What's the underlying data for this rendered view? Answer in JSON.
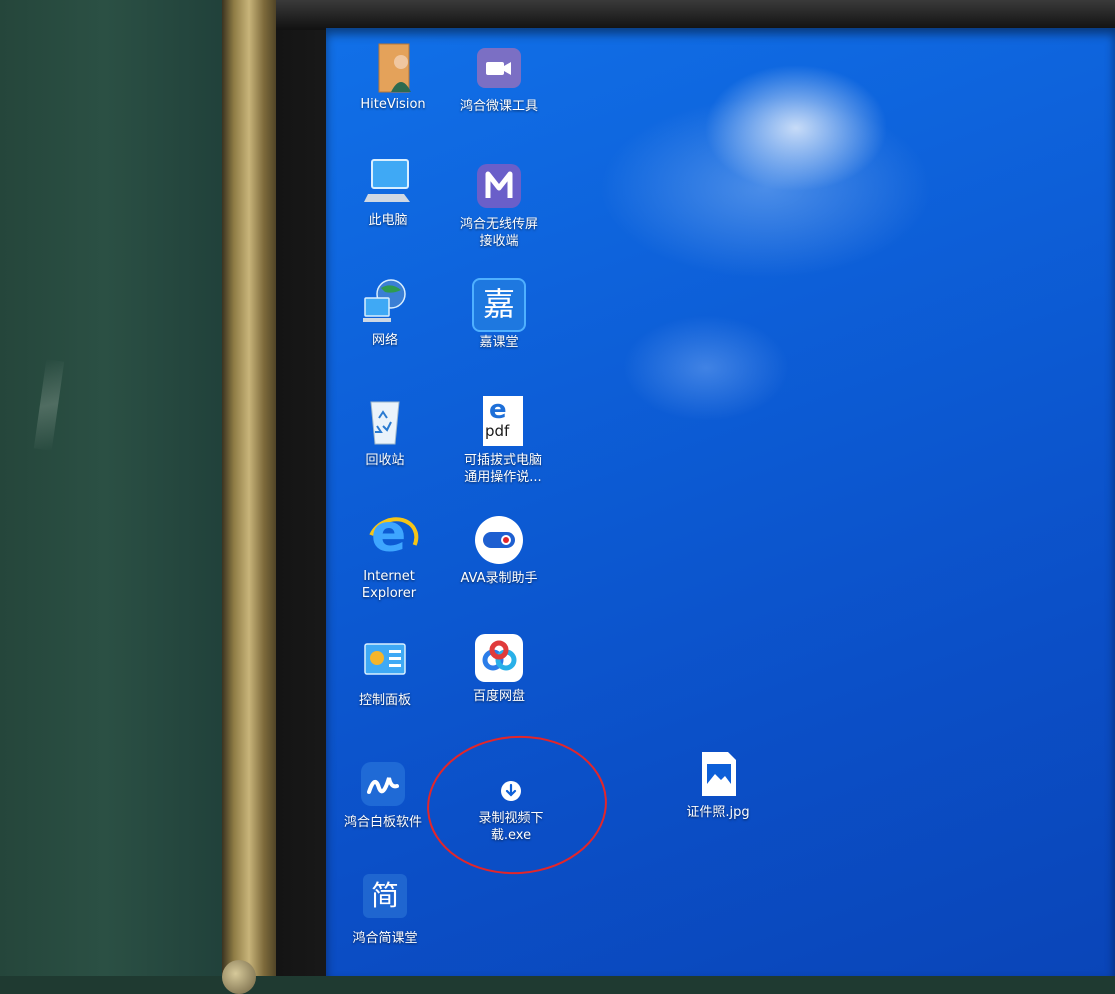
{
  "desktop": {
    "icons": [
      {
        "label": "HiteVision",
        "icon": "person-hitevision-icon"
      },
      {
        "label": "鸿合微课工具",
        "icon": "video-camera-icon"
      },
      {
        "label": "此电脑",
        "icon": "computer-icon"
      },
      {
        "label": "鸿合无线传屏\n接收端",
        "icon": "wireless-screen-icon"
      },
      {
        "label": "网络",
        "icon": "network-globe-icon"
      },
      {
        "label": "嘉课堂",
        "icon": "jia-classroom-icon",
        "glyph": "嘉"
      },
      {
        "label": "回收站",
        "icon": "recycle-bin-icon"
      },
      {
        "label": "可插拔式电脑\n通用操作说...",
        "icon": "pdf-file-icon",
        "glyph": "pdf"
      },
      {
        "label": "Internet\nExplorer",
        "icon": "internet-explorer-icon",
        "glyph": "e"
      },
      {
        "label": "AVA录制助手",
        "icon": "ava-record-icon"
      },
      {
        "label": "控制面板",
        "icon": "control-panel-icon"
      },
      {
        "label": "百度网盘",
        "icon": "baidu-netdisk-icon"
      },
      {
        "label": "鸿合白板软件",
        "icon": "whiteboard-pen-icon"
      },
      {
        "label": "录制视频下\n载.exe",
        "icon": "download-arrow-icon"
      },
      {
        "label": "证件照.jpg",
        "icon": "image-file-icon"
      },
      {
        "label": "鸿合简课堂",
        "icon": "jian-classroom-icon",
        "glyph": "简"
      }
    ]
  },
  "colors": {
    "desktop_blue": "#0d5fd8",
    "highlight_circle": "#e3262a"
  }
}
